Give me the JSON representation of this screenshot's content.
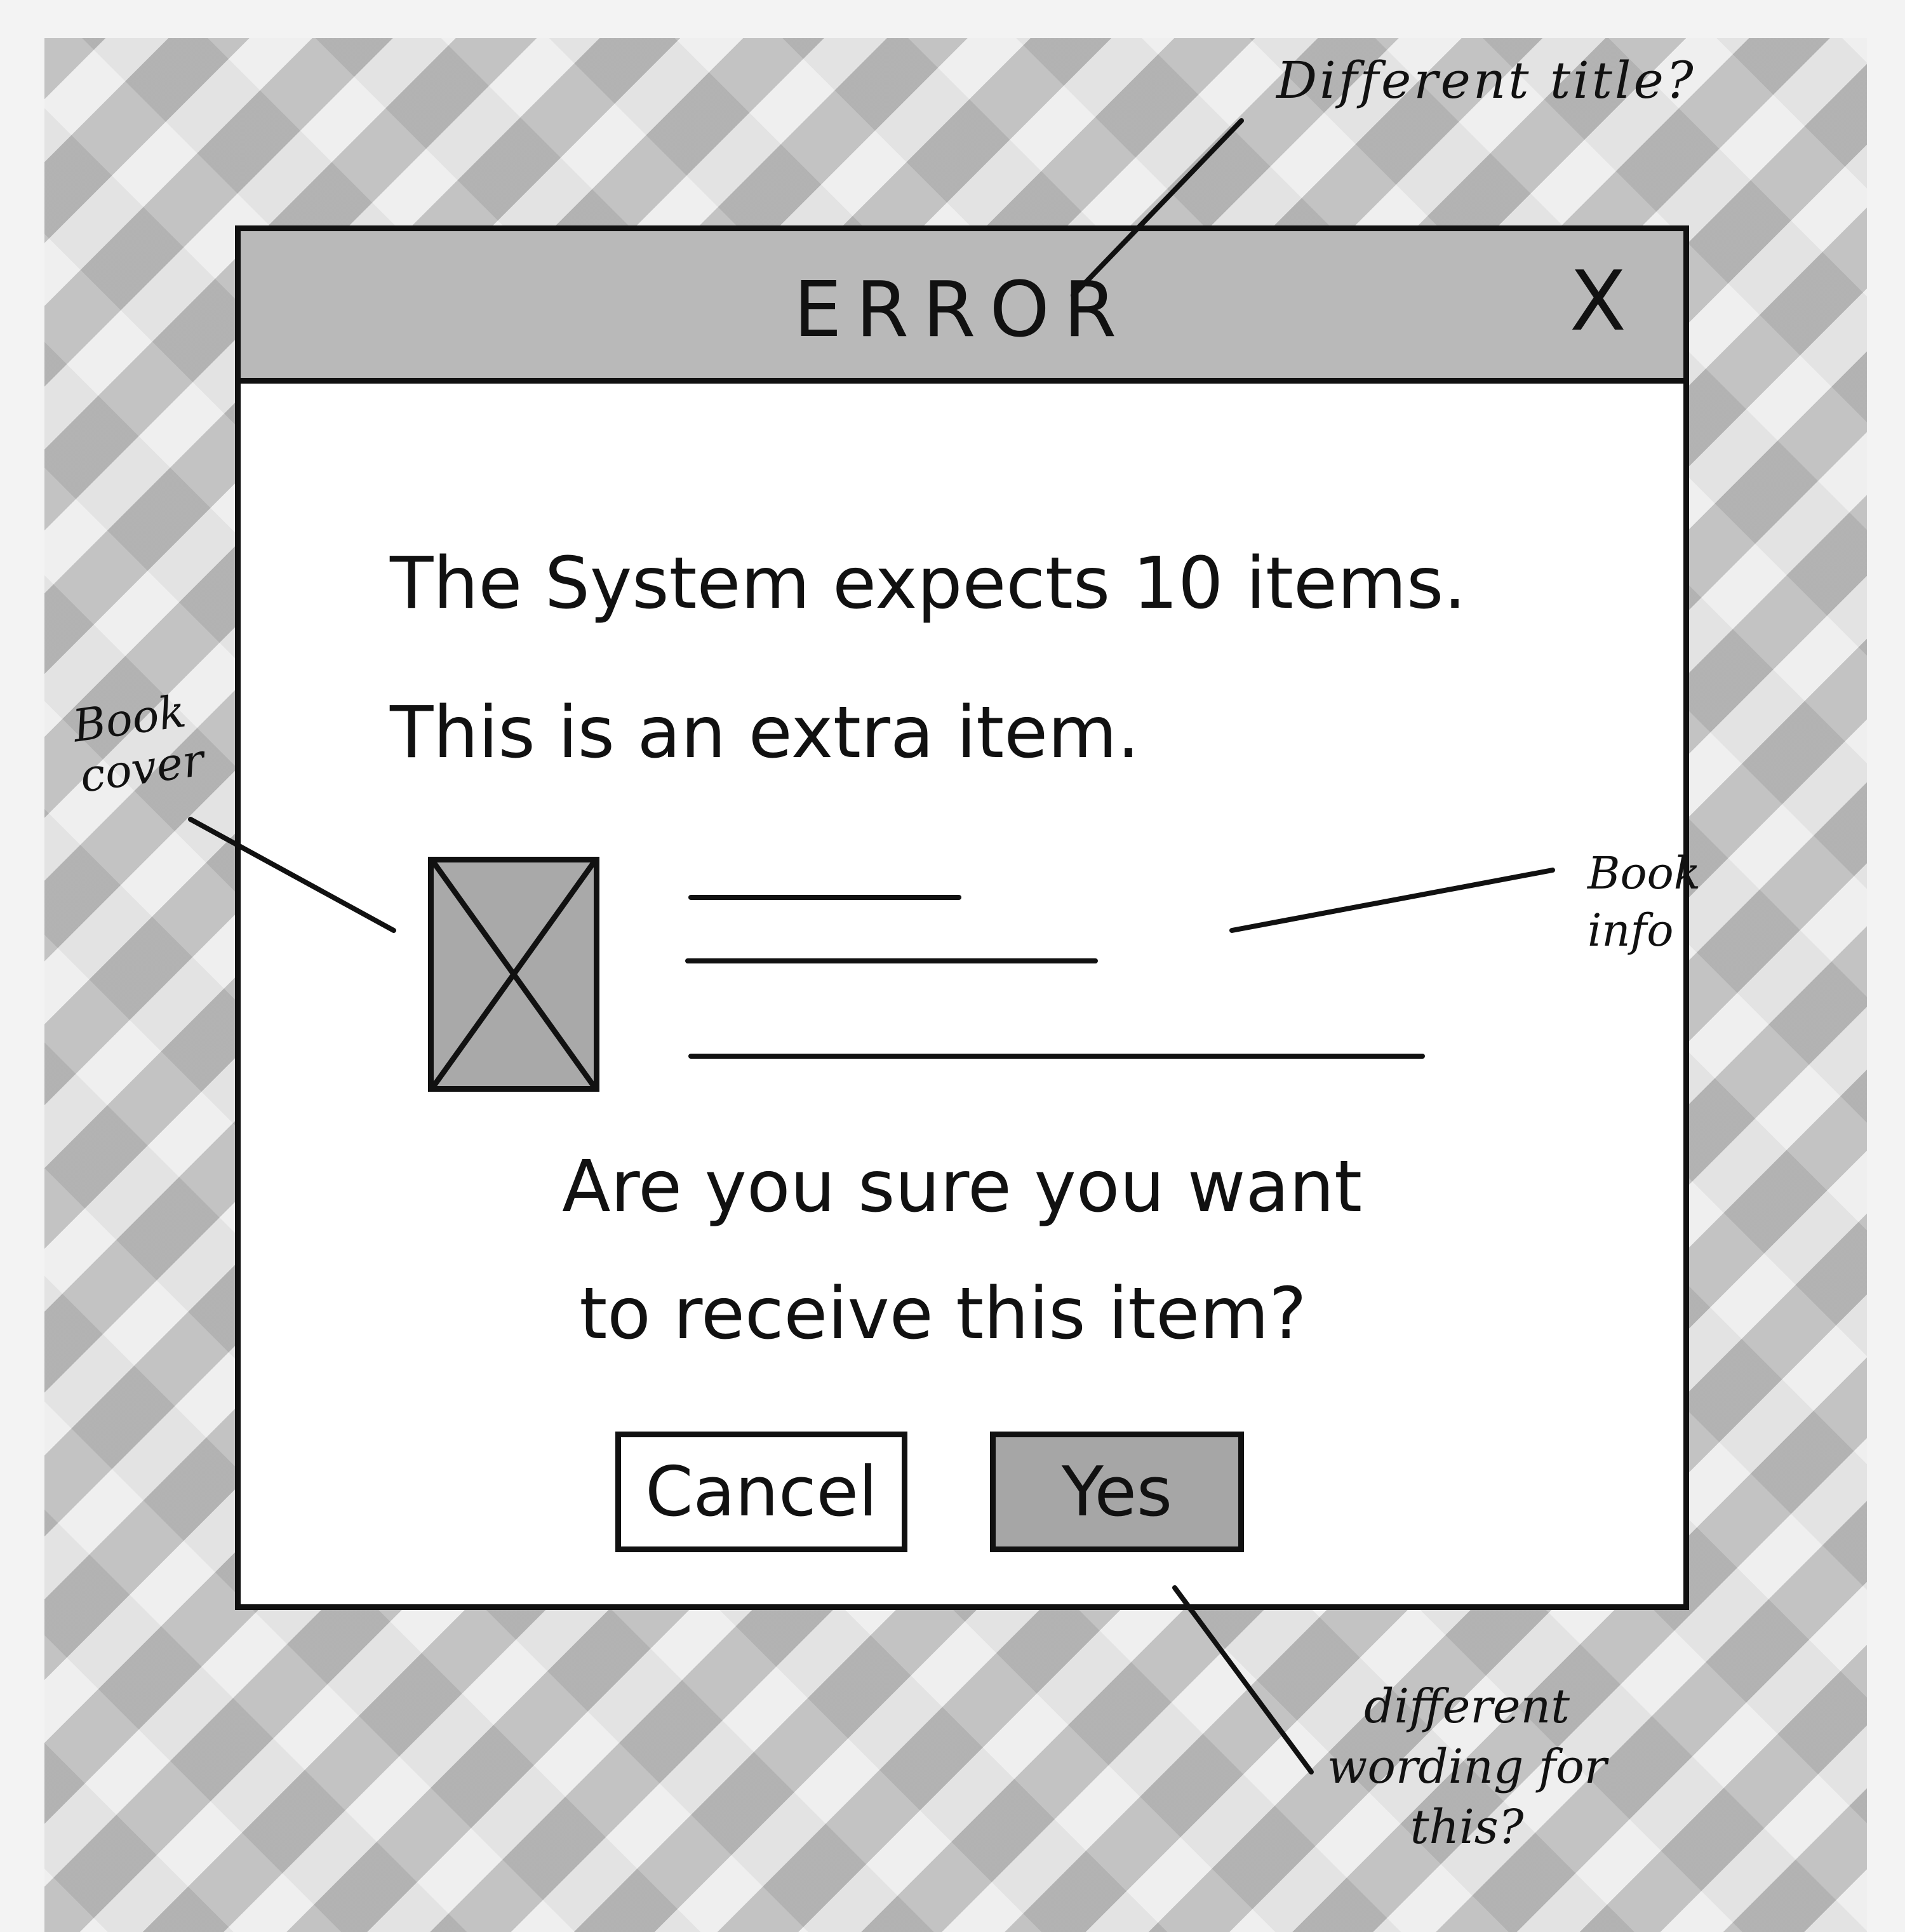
{
  "dialog": {
    "title": "ERROR",
    "close_label": "X",
    "message_line1": "The System expects 10 items.",
    "message_line2": "This is an extra item.",
    "question_line1": "Are you sure you want",
    "question_line2": "to receive this item?",
    "buttons": {
      "cancel_label": "Cancel",
      "yes_label": "Yes"
    }
  },
  "annotations": {
    "title_note": "Different title?",
    "cover_note_line1": "Book",
    "cover_note_line2": "cover",
    "info_note_line1": "Book",
    "info_note_line2": "info",
    "button_note_line1": "different",
    "button_note_line2": "wording for",
    "button_note_line3": "this?"
  },
  "icons": {
    "close": "close-icon",
    "book_cover": "image-placeholder-icon"
  },
  "colors": {
    "titlebar": "#b9b9b9",
    "yes_button": "#a6a6a6",
    "cover_placeholder": "#a9a9a9"
  }
}
